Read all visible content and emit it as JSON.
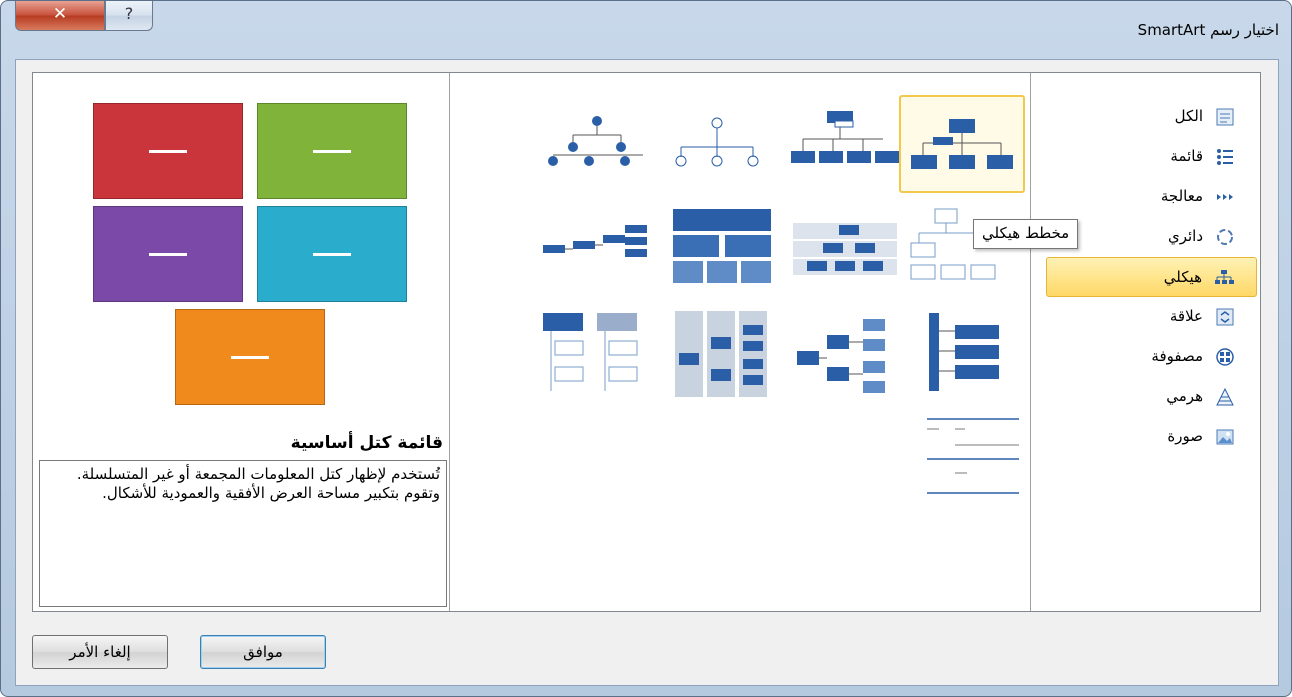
{
  "window": {
    "title": "اختيار رسم SmartArt",
    "close_glyph": "✕",
    "help_glyph": "?"
  },
  "categories": [
    {
      "label": "الكل",
      "icon": "all-icon"
    },
    {
      "label": "قائمة",
      "icon": "list-icon"
    },
    {
      "label": "معالجة",
      "icon": "process-icon"
    },
    {
      "label": "دائري",
      "icon": "cycle-icon"
    },
    {
      "label": "هيكلي",
      "icon": "hierarchy-icon",
      "selected": true
    },
    {
      "label": "علاقة",
      "icon": "relationship-icon"
    },
    {
      "label": "مصفوفة",
      "icon": "matrix-icon"
    },
    {
      "label": "هرمي",
      "icon": "pyramid-icon"
    },
    {
      "label": "صورة",
      "icon": "picture-icon"
    }
  ],
  "tooltip": "مخطط هيكلي",
  "preview": {
    "title": "قائمة كتل أساسية",
    "description": "تُستخدم لإظهار كتل المعلومات المجمعة أو غير المتسلسلة. وتقوم بتكبير مساحة العرض الأفقية والعمودية للأشكال.",
    "colors": [
      "#c0392b",
      "#7fb33a",
      "#7b4aa8",
      "#2aaccc",
      "#f08a1c"
    ]
  },
  "buttons": {
    "ok": "موافق",
    "cancel": "إلغاء الأمر"
  },
  "colors": {
    "accent_selected": "#ffd866",
    "layout_blue": "#2a5fa7"
  }
}
